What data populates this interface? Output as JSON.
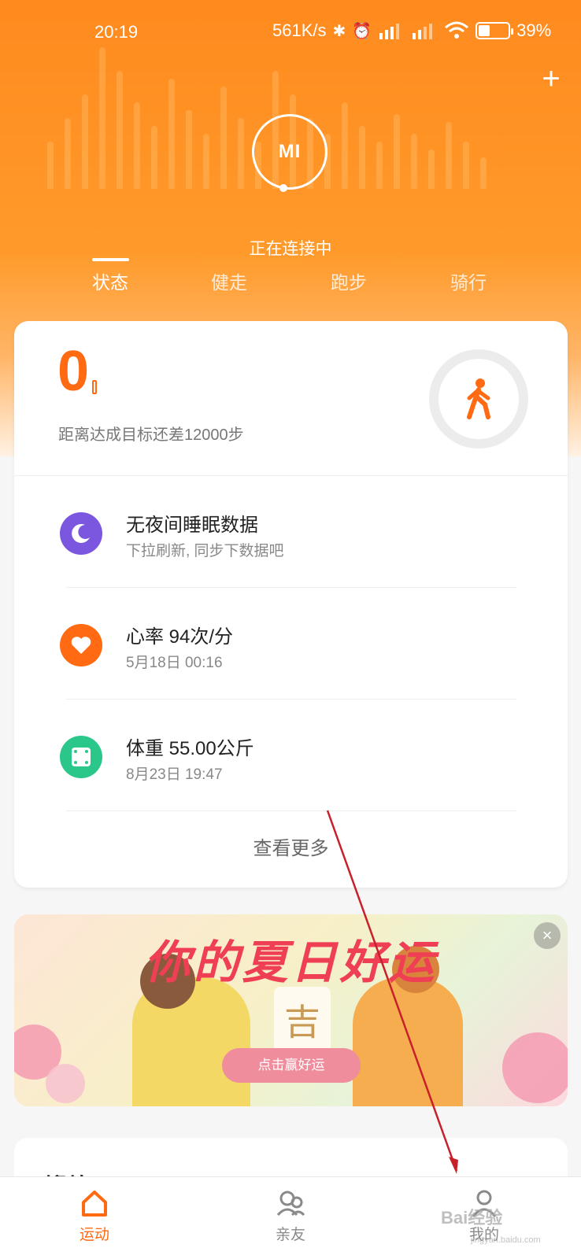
{
  "status_bar": {
    "time": "20:19",
    "network_speed": "561K/s",
    "battery_text": "39%",
    "battery_level": 0.39
  },
  "header": {
    "connect_status": "正在连接中",
    "device_logo": "MI",
    "add_icon": "plus-icon"
  },
  "tabs": [
    {
      "label": "状态",
      "active": true
    },
    {
      "label": "健走",
      "active": false
    },
    {
      "label": "跑步",
      "active": false
    },
    {
      "label": "骑行",
      "active": false
    }
  ],
  "steps": {
    "value": "0",
    "goal_text": "距离达成目标还差12000步",
    "progress": 0
  },
  "health_rows": [
    {
      "title": "无夜间睡眠数据",
      "sub": "下拉刷新, 同步下数据吧",
      "icon": "moon-icon",
      "color": "#7b57e0"
    },
    {
      "title": "心率 94次/分",
      "sub": "5月18日 00:16",
      "icon": "heart-icon",
      "color": "#ff6a13"
    },
    {
      "title": "体重 55.00公斤",
      "sub": "8月23日 19:47",
      "icon": "scale-icon",
      "color": "#2bc78a"
    }
  ],
  "see_more": "查看更多",
  "banner": {
    "title": "你的夏日好运",
    "ji": "吉",
    "cta": "点击赢好运"
  },
  "exercise_card": {
    "label": "锻炼"
  },
  "bottom_nav": [
    {
      "label": "运动",
      "icon": "home-icon",
      "active": true
    },
    {
      "label": "亲友",
      "icon": "friends-icon",
      "active": false
    },
    {
      "label": "我的",
      "icon": "profile-icon",
      "active": false
    }
  ],
  "watermark": {
    "brand": "Bai经验",
    "url": "jingyan.baidu.com"
  },
  "colors": {
    "accent": "#ff6a13",
    "header": "#ff8a1e"
  }
}
